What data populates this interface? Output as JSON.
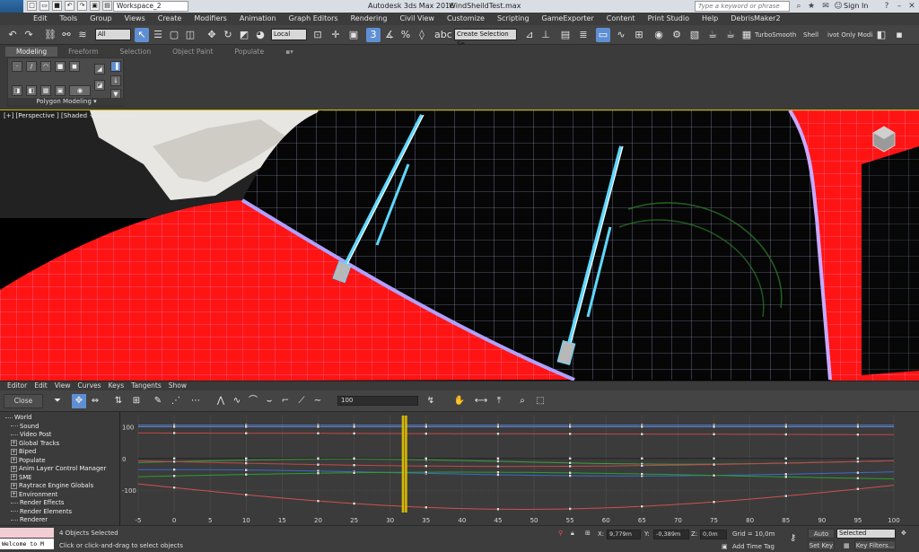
{
  "app": {
    "logo_label": "MAX",
    "workspace": "Workspace_2",
    "title": "Autodesk 3ds Max 2016",
    "filename": "WindSheildTest.max",
    "search_placeholder": "Type a keyword or phrase",
    "sign_in": "Sign In"
  },
  "menu": [
    "Edit",
    "Tools",
    "Group",
    "Views",
    "Create",
    "Modifiers",
    "Animation",
    "Graph Editors",
    "Rendering",
    "Civil View",
    "Customize",
    "Scripting",
    "GameExporter",
    "Content",
    "Print Studio",
    "Help",
    "DebrisMaker2"
  ],
  "toolbar": {
    "selection_filter": "All",
    "coord_system": "Local",
    "named_selection": "Create Selection Se",
    "turbosmooth": "TurboSmooth",
    "shell": "Shell",
    "pivot_only": "ivot Only Modi"
  },
  "ribbon": {
    "tabs": [
      "Modeling",
      "Freeform",
      "Selection",
      "Object Paint",
      "Populate"
    ],
    "panel_label": "Polygon Modeling"
  },
  "viewport": {
    "label": "[+] [Perspective ] [Shaded + Edged Faces ]"
  },
  "curve_editor": {
    "menu": [
      "Editor",
      "Edit",
      "View",
      "Curves",
      "Keys",
      "Tangents",
      "Show"
    ],
    "close_label": "Close",
    "value_field": "100",
    "tree": [
      {
        "label": "World",
        "level": 0,
        "exp": ""
      },
      {
        "label": "Sound",
        "level": 1,
        "exp": ""
      },
      {
        "label": "Video Post",
        "level": 1,
        "exp": ""
      },
      {
        "label": "Global Tracks",
        "level": 1,
        "exp": "+"
      },
      {
        "label": "Biped",
        "level": 1,
        "exp": "+"
      },
      {
        "label": "Populate",
        "level": 1,
        "exp": "+"
      },
      {
        "label": "Anim Layer Control Manager",
        "level": 1,
        "exp": "+"
      },
      {
        "label": "SME",
        "level": 1,
        "exp": "+"
      },
      {
        "label": "Raytrace Engine Globals",
        "level": 1,
        "exp": "+"
      },
      {
        "label": "Environment",
        "level": 1,
        "exp": "+"
      },
      {
        "label": "Render Effects",
        "level": 1,
        "exp": ""
      },
      {
        "label": "Render Elements",
        "level": 1,
        "exp": ""
      },
      {
        "label": "Renderer",
        "level": 1,
        "exp": ""
      }
    ]
  },
  "chart_data": {
    "type": "line",
    "x_ticks": [
      -5,
      0,
      5,
      10,
      15,
      20,
      25,
      30,
      35,
      40,
      45,
      50,
      55,
      60,
      65,
      70,
      75,
      80,
      85,
      90,
      95,
      100
    ],
    "y_ticks": [
      100,
      0,
      -100
    ],
    "xlim": [
      -5,
      100
    ],
    "ylim": [
      -170,
      135
    ],
    "current_frame": 32,
    "grid": true
  },
  "status": {
    "maxscript": "Welcome to M",
    "objects_selected": "4 Objects Selected",
    "prompt": "Click or click-and-drag to select objects",
    "x_label": "X:",
    "x_value": "9,779m",
    "y_label": "Y:",
    "y_value": "-0,389m",
    "z_label": "Z:",
    "z_value": "0,0m",
    "grid": "Grid = 10,0m",
    "add_time_tag": "Add Time Tag",
    "auto_key": "Auto Key",
    "set_key": "Set Key",
    "selected_dropdown": "Selected",
    "key_filters": "Key Filters..."
  },
  "colors": {
    "viewport_car": "#ff1414",
    "wireframe": "#c8d2ff",
    "selection": "#4fd0ff",
    "time_slider": "#e6c700"
  }
}
